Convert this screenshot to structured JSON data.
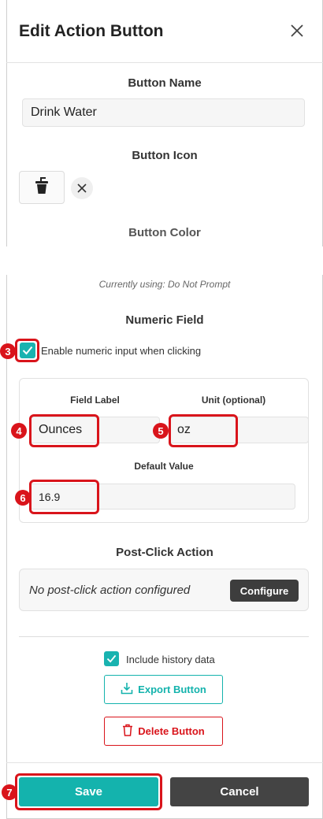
{
  "dialog": {
    "title": "Edit Action Button"
  },
  "button_name": {
    "label": "Button Name",
    "value": "Drink Water"
  },
  "button_icon": {
    "label": "Button Icon",
    "icon": "cup-icon"
  },
  "button_color": {
    "label": "Button Color",
    "hint": "Currently using: Do Not Prompt"
  },
  "numeric_field": {
    "label": "Numeric Field",
    "enable_label": "Enable numeric input when clicking",
    "enabled": true,
    "field_label_header": "Field Label",
    "field_label_value": "Ounces",
    "unit_header": "Unit (optional)",
    "unit_value": "oz",
    "default_value_header": "Default Value",
    "default_value": "16.9"
  },
  "post_click": {
    "label": "Post-Click Action",
    "empty_text": "No post-click action configured",
    "configure_label": "Configure"
  },
  "history": {
    "label": "Include history data",
    "checked": true
  },
  "actions": {
    "export_label": "Export Button",
    "delete_label": "Delete Button",
    "save_label": "Save",
    "cancel_label": "Cancel"
  },
  "annotations": [
    "3",
    "4",
    "5",
    "6",
    "7"
  ],
  "colors": {
    "accent": "#14b3ad",
    "danger": "#d9141b",
    "dark": "#444444"
  }
}
